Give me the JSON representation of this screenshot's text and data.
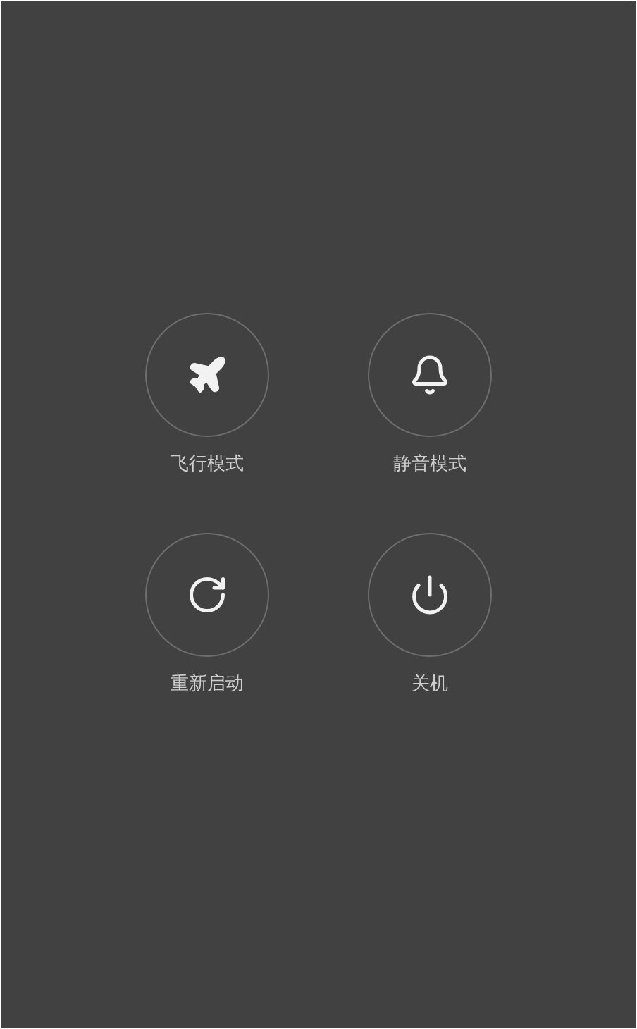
{
  "actions": [
    {
      "kind": "airplane",
      "label": "飞行模式"
    },
    {
      "kind": "silent",
      "label": "静音模式"
    },
    {
      "kind": "restart",
      "label": "重新启动"
    },
    {
      "kind": "power",
      "label": "关机"
    }
  ]
}
